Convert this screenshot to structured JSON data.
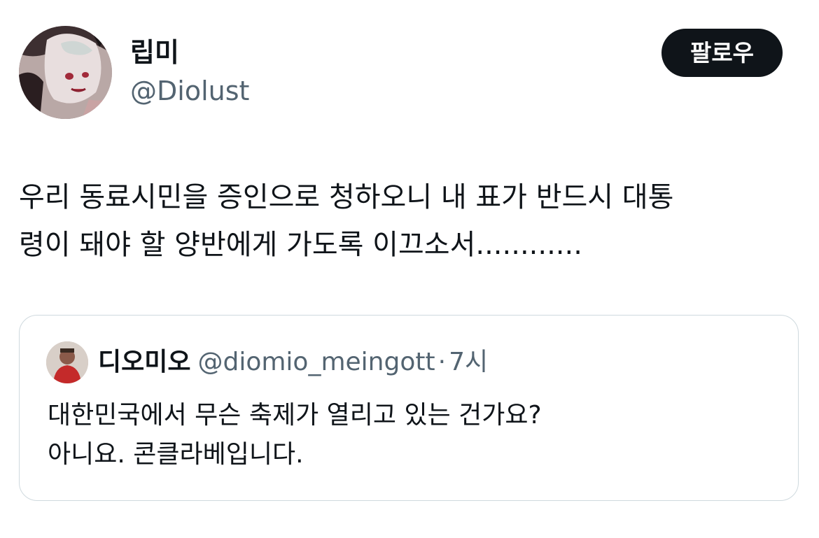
{
  "author": {
    "display_name": "립미",
    "handle": "@Diolust",
    "avatar_icon": "user-avatar"
  },
  "follow_button": {
    "label": "팔로우",
    "background": "#0f1419",
    "color": "#ffffff"
  },
  "tweet": {
    "line1": "우리 동료시민을 증인으로 청하오니 내 표가 반드시 대통",
    "line2": "령이 돼야 할 양반에게 가도록 이끄소서............"
  },
  "quoted_tweet": {
    "display_name": "디오미오",
    "handle": "@diomio_meingott",
    "separator": "·",
    "time": "7시",
    "line1": "대한민국에서 무슨 축제가 열리고 있는 건가요?",
    "line2": "아니요. 콘클라베입니다.",
    "avatar_icon": "user-avatar"
  },
  "colors": {
    "text": "#0f1419",
    "secondary": "#536471",
    "border": "#cfd9de"
  }
}
